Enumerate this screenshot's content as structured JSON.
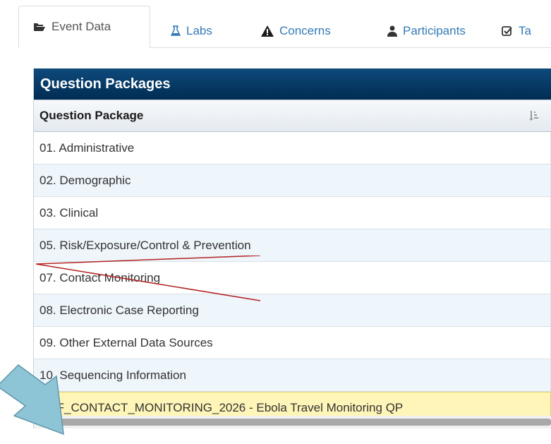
{
  "tabs": [
    {
      "label": "Event Data",
      "icon": "folder-open-icon"
    },
    {
      "label": "Labs",
      "icon": "flask-icon"
    },
    {
      "label": "Concerns",
      "icon": "warning-icon"
    },
    {
      "label": "Participants",
      "icon": "user-icon"
    },
    {
      "label": "Ta",
      "icon": "checkbox-icon"
    }
  ],
  "panel": {
    "title": "Question Packages",
    "column_header": "Question Package"
  },
  "rows": [
    "01. Administrative",
    "02. Demographic",
    "03. Clinical",
    "05. Risk/Exposure/Control & Prevention",
    "07. Contact Monitoring",
    "08. Electronic Case Reporting",
    "09. Other External Data Sources",
    "10. Sequencing Information",
    "VHF_CONTACT_MONITORING_2026 - Ebola Travel Monitoring QP"
  ],
  "colors": {
    "panel_header": "#0e4a7c",
    "selected_row": "#fff5b8",
    "strike_line": "#b22222",
    "arrow_fill": "#8ec5d6"
  }
}
